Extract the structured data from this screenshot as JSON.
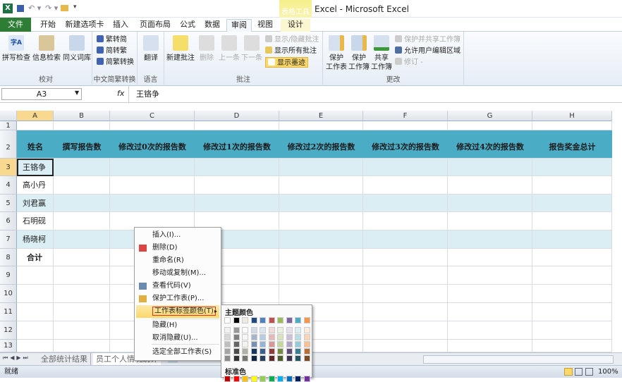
{
  "title": {
    "text": "Excel - Microsoft Excel",
    "context_tools": "表格工具"
  },
  "tabs": [
    "文件",
    "开始",
    "新建选项卡",
    "插入",
    "页面布局",
    "公式",
    "数据",
    "审阅",
    "视图",
    "设计"
  ],
  "ribbon": {
    "proofing": {
      "label": "校对",
      "buttons": [
        "拼写检查",
        "信息检索",
        "同义词库"
      ]
    },
    "chinese": {
      "label": "中文简繁转换",
      "buttons": [
        "繁转简",
        "简转繁",
        "简繁转换"
      ]
    },
    "language": {
      "label": "语言",
      "buttons": [
        "翻译"
      ]
    },
    "comments": {
      "label": "批注",
      "buttons": [
        "新建批注",
        "删除",
        "上一条",
        "下一条"
      ],
      "small": [
        "显示/隐藏批注",
        "显示所有批注",
        "显示墨迹"
      ]
    },
    "changes": {
      "label": "更改",
      "buttons": [
        [
          "保护",
          "工作表"
        ],
        [
          "保护",
          "工作簿"
        ],
        [
          "共享",
          "工作簿"
        ]
      ],
      "small": [
        "保护并共享工作簿",
        "允许用户编辑区域",
        "修订 -"
      ]
    }
  },
  "formula_bar": {
    "name_box": "A3",
    "fx": "fx",
    "value": "王铬争"
  },
  "columns": [
    "A",
    "B",
    "C",
    "D",
    "E",
    "F",
    "G",
    "H"
  ],
  "rows": [
    "1",
    "2",
    "3",
    "4",
    "5",
    "6",
    "7",
    "8",
    "9",
    "10",
    "11",
    "12",
    "13"
  ],
  "table": {
    "headers": [
      "姓名",
      "撰写报告数",
      "修改过0次的报告数",
      "修改过1次的报告数",
      "修改过2次的报告数",
      "修改过3次的报告数",
      "修改过4次的报告数",
      "报告奖金总计"
    ],
    "names": [
      "王铬争",
      "高小丹",
      "刘君赢",
      "石明砚",
      "杨晓柯"
    ],
    "total": "合计"
  },
  "context_menu": {
    "items": [
      "插入(I)...",
      "删除(D)",
      "重命名(R)",
      "移动或复制(M)...",
      "查看代码(V)",
      "保护工作表(P)...",
      "工作表标签颜色(T)",
      "隐藏(H)",
      "取消隐藏(U)...",
      "选定全部工作表(S)"
    ]
  },
  "color_submenu": {
    "theme_label": "主题颜色",
    "standard_label": "标准色",
    "theme_colors": [
      "#ffffff",
      "#000000",
      "#eeece1",
      "#1f497d",
      "#4f81bd",
      "#c0504d",
      "#9bbb59",
      "#8064a2",
      "#4bacc6",
      "#f79646"
    ],
    "standard_colors": [
      "#c00000",
      "#ff0000",
      "#ffc000",
      "#ffff00",
      "#92d050",
      "#00b050",
      "#00b0f0",
      "#0070c0",
      "#002060",
      "#7030a0"
    ]
  },
  "sheet_tabs": [
    "全部统计结果",
    "员工个人情况统计"
  ],
  "status": {
    "ready": "就绪",
    "zoom": "100%"
  }
}
